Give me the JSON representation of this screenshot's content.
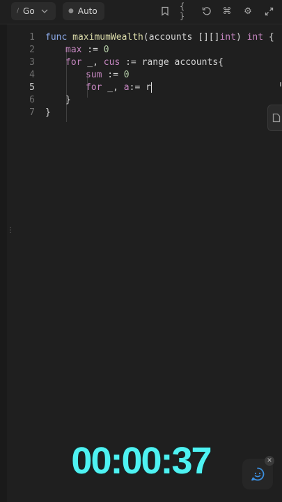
{
  "toolbar": {
    "language": "Go",
    "mode": "Auto",
    "icons": [
      "bookmark-icon",
      "braces-icon",
      "reset-icon",
      "command-icon",
      "gear-icon",
      "expand-icon"
    ]
  },
  "editor": {
    "lines": [
      {
        "num": "1"
      },
      {
        "num": "2"
      },
      {
        "num": "3"
      },
      {
        "num": "4"
      },
      {
        "num": "5"
      },
      {
        "num": "6"
      },
      {
        "num": "7"
      }
    ],
    "tokens": {
      "l1_func": "func",
      "l1_name": "maximumWealth",
      "l1_open": "(accounts [][]",
      "l1_int": "int",
      "l1_close": ") ",
      "l1_ret": "int",
      "l1_brace": " {",
      "l2_var": "max",
      "l2_op": " := ",
      "l2_num": "0",
      "l3_for": "for",
      "l3_rest": " _, ",
      "l3_cus": "cus",
      "l3_op": " := range accounts{",
      "l4_var": "sum",
      "l4_op": " := ",
      "l4_num": "0",
      "l5_for": "for",
      "l5_rest": " _, ",
      "l5_a": "a",
      "l5_op": ":= r",
      "l6": "}",
      "l7": "}"
    },
    "active_line": 5
  },
  "timer": "00:00:37",
  "colors": {
    "background": "#1f1f1f",
    "timer": "#4ef2f2",
    "keyword": "#c586c0",
    "chat": "#3b8fe0"
  }
}
